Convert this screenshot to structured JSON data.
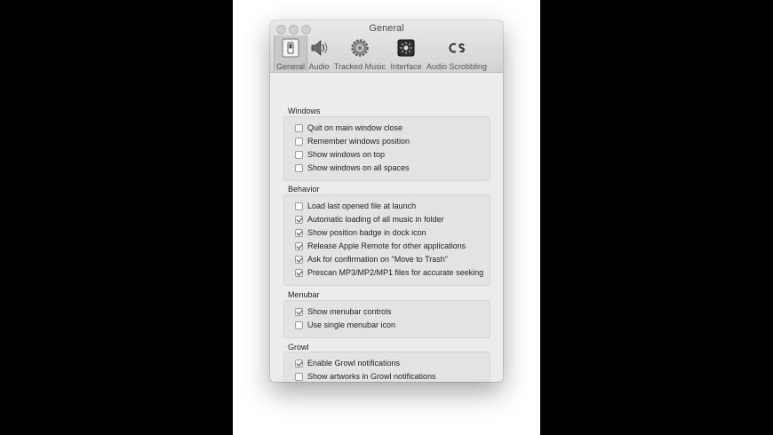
{
  "window": {
    "title": "General"
  },
  "toolbar": {
    "items": [
      {
        "label": "General",
        "icon": "general-switch-icon",
        "selected": true
      },
      {
        "label": "Audio",
        "icon": "speaker-icon"
      },
      {
        "label": "Tracked Music",
        "icon": "gear-icon"
      },
      {
        "label": "Interface",
        "icon": "interface-icon"
      },
      {
        "label": "Audio Scrobbling",
        "icon": "lastfm-icon"
      }
    ]
  },
  "sections": [
    {
      "title": "Windows",
      "options": [
        {
          "label": "Quit on main window close",
          "checked": false
        },
        {
          "label": "Remember windows position",
          "checked": false
        },
        {
          "label": "Show windows on top",
          "checked": false
        },
        {
          "label": "Show windows on all spaces",
          "checked": false
        }
      ]
    },
    {
      "title": "Behavior",
      "options": [
        {
          "label": "Load last opened file at launch",
          "checked": false
        },
        {
          "label": "Automatic loading of all music in folder",
          "checked": true
        },
        {
          "label": "Show position badge in dock icon",
          "checked": true
        },
        {
          "label": "Release Apple Remote for other applications",
          "checked": true
        },
        {
          "label": "Ask for confirmation on \"Move to Trash\"",
          "checked": true
        },
        {
          "label": "Prescan MP3/MP2/MP1 files for accurate seeking",
          "checked": true
        }
      ]
    },
    {
      "title": "Menubar",
      "options": [
        {
          "label": "Show menubar controls",
          "checked": true
        },
        {
          "label": "Use single menubar icon",
          "checked": false
        }
      ]
    },
    {
      "title": "Growl",
      "options": [
        {
          "label": "Enable Growl notifications",
          "checked": true
        },
        {
          "label": "Show artworks in Growl notifications",
          "checked": false
        }
      ]
    }
  ]
}
